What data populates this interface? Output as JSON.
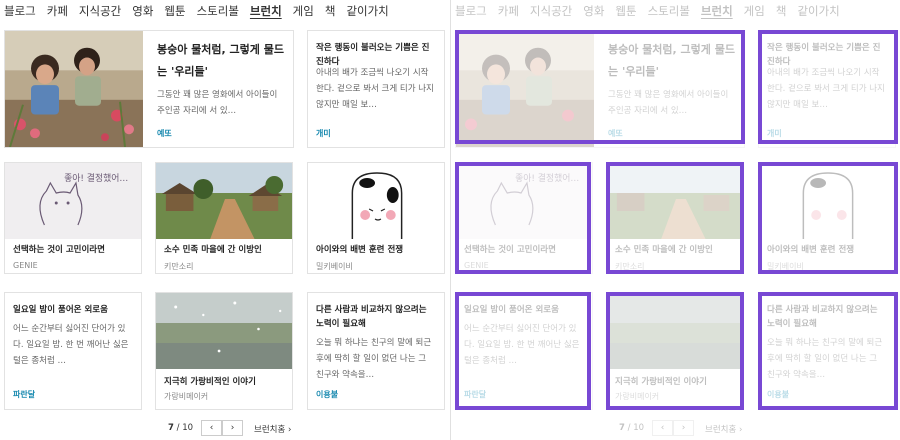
{
  "nav": [
    "블로그",
    "카페",
    "지식공간",
    "영화",
    "웹툰",
    "스토리볼",
    "브런치",
    "게임",
    "책",
    "같이가치"
  ],
  "nav_active": "브런치",
  "cards": [
    {
      "title": "봉숭아 물처럼, 그렇게 물드는 '우리들'",
      "body": "그동안 꽤 많은 영화에서 아이들이 주인공 자리에 서 있…",
      "author": "예또"
    },
    {
      "title": "작은 행동이 불러오는 기쁨은 진진하다",
      "body": "아내의 배가 조금씩 나오기 시작한다. 겉으로 봐서 크게 티가 나지 않지만 매일 보…",
      "author": "개미"
    },
    {
      "title": "선택하는 것이 고민이라면",
      "author": "GENIE"
    },
    {
      "title": "소수 민족 마을에 간 이방인",
      "author": "키만소리"
    },
    {
      "title": "아이와의 배변 훈련 전쟁",
      "author": "밀키베이비"
    },
    {
      "title": "일요일 밤이 품어온 외로움",
      "body": "어느 순간부터 싫어진 단어가 있다. 일요일 밤. 한 번 깨어난 싫은 털은 종처럼 …",
      "author": "파란달"
    },
    {
      "title": "지극히 가랑비적인 이야기",
      "author": "가랑비메이커"
    },
    {
      "title": "다른 사람과 비교하지 않으려는 노력이 필요해",
      "body": "오늘 뭐 하냐는 친구의 말에 퇴근 후에 딱히 할 일이 없던 나는 그 친구와 약속을…",
      "author": "이용불"
    }
  ],
  "drawing_text": "좋아! 결정했어…",
  "pager": {
    "current": "7",
    "total": "/ 10",
    "prev": "‹",
    "next": "›",
    "more": "브런치홈 ›"
  },
  "colors": {
    "highlight": "#7848d4",
    "author_blue": "#1a8ab0"
  },
  "icons": {
    "prev": "chevron-left-icon",
    "next": "chevron-right-icon"
  }
}
